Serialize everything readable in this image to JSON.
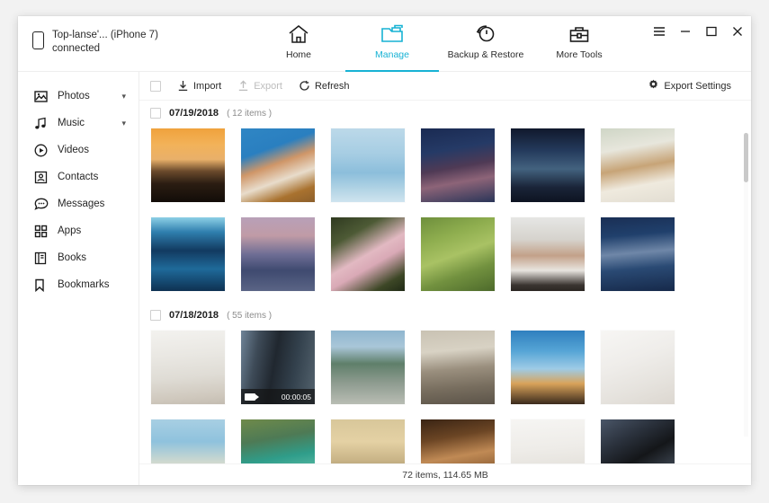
{
  "window": {
    "device_name": "Top-lanse'... (iPhone 7)",
    "device_status": "connected",
    "controls": [
      {
        "name": "menu",
        "glyph": "☰"
      },
      {
        "name": "minimize",
        "glyph": "−"
      },
      {
        "name": "maximize",
        "glyph": "☐"
      },
      {
        "name": "close",
        "glyph": "✕"
      }
    ]
  },
  "tabs": [
    {
      "id": "home",
      "label": "Home",
      "icon": "home-icon",
      "active": false
    },
    {
      "id": "manage",
      "label": "Manage",
      "icon": "folder-icon",
      "active": true
    },
    {
      "id": "backup",
      "label": "Backup & Restore",
      "icon": "restore-icon",
      "active": false
    },
    {
      "id": "tools",
      "label": "More Tools",
      "icon": "toolbox-icon",
      "active": false
    }
  ],
  "accent_color": "#17b2d4",
  "sidebar": {
    "items": [
      {
        "label": "Photos",
        "icon": "photo-icon",
        "expandable": true
      },
      {
        "label": "Music",
        "icon": "music-note-icon",
        "expandable": true
      },
      {
        "label": "Videos",
        "icon": "play-circle-icon",
        "expandable": false
      },
      {
        "label": "Contacts",
        "icon": "contact-card-icon",
        "expandable": false
      },
      {
        "label": "Messages",
        "icon": "chat-bubble-icon",
        "expandable": false
      },
      {
        "label": "Apps",
        "icon": "grid-squares-icon",
        "expandable": false
      },
      {
        "label": "Books",
        "icon": "book-icon",
        "expandable": false
      },
      {
        "label": "Bookmarks",
        "icon": "bookmark-icon",
        "expandable": false
      }
    ]
  },
  "toolbar": {
    "import_label": "Import",
    "export_label": "Export",
    "refresh_label": "Refresh",
    "export_settings_label": "Export Settings",
    "export_disabled": true
  },
  "groups": [
    {
      "date": "07/19/2018",
      "count_label": "( 12 items )",
      "items": [
        {
          "kind": "photo",
          "desc": "orange-sunset-beach",
          "art": "linear-gradient(180deg,#f0a23c 0%,#f2b259 22%,#e9b06a 42%,#6b4a2c 58%,#2b1d12 75%,#120c08 100%)"
        },
        {
          "kind": "photo",
          "desc": "woman-sunhat-pool",
          "art": "linear-gradient(160deg,#2f86c4 0%,#2a7fc0 30%,#cf9668 48%,#e8dccb 66%,#a9722f 84%,#8c5f2b 100%)"
        },
        {
          "kind": "photo",
          "desc": "aerial-pool-swimmer",
          "art": "linear-gradient(180deg,#bcd9e9 0%,#a6cde3 35%,#8cbedb 60%,#b6d6e6 85%,#cfe4ef 100%)"
        },
        {
          "kind": "photo",
          "desc": "cherry-blossom-night",
          "art": "linear-gradient(170deg,#1a2a52 0%,#253a66 30%,#4f3a55 52%,#8d6478 70%,#2a3558 100%)"
        },
        {
          "kind": "photo",
          "desc": "japan-alley-lanterns",
          "art": "linear-gradient(180deg,#10182c 0%,#243a5c 30%,#43627f 55%,#1a2438 80%,#0d1321 100%)"
        },
        {
          "kind": "photo",
          "desc": "deer-in-snow",
          "art": "linear-gradient(170deg,#cfd6c6 0%,#e7e6dc 28%,#c7a477 52%,#efeade 74%,#e2ddd2 100%)"
        },
        {
          "kind": "photo",
          "desc": "beluga-whale-tank",
          "art": "linear-gradient(180deg,#8dd0e6 0%,#2f7fae 20%,#123a60 45%,#1f6a9a 70%,#0e3152 100%)"
        },
        {
          "kind": "photo",
          "desc": "dusk-mountain-lake",
          "art": "linear-gradient(180deg,#b8a0b8 0%,#c09ba6 25%,#6f6e95 50%,#3f4a70 72%,#5a6485 100%)"
        },
        {
          "kind": "photo",
          "desc": "pink-hydrangea-flower",
          "art": "linear-gradient(150deg,#2f3a20 0%,#4d5a35 25%,#e2b9c2 50%,#d9a9b6 62%,#3d4726 85%,#202a16 100%)"
        },
        {
          "kind": "photo",
          "desc": "aerial-green-rice-fields",
          "art": "linear-gradient(160deg,#6e8f3c 0%,#8fae4f 28%,#a9c264 50%,#72913f 72%,#4d6a2b 100%)"
        },
        {
          "kind": "photo",
          "desc": "hands-washing-vegetables",
          "art": "linear-gradient(180deg,#e6e6e4 0%,#d6d3cd 30%,#c3a189 52%,#e8e4df 72%,#3a3430 92%,#2b2622 100%)"
        },
        {
          "kind": "photo",
          "desc": "dark-ocean-waves",
          "art": "linear-gradient(175deg,#1a2f55 0%,#20406c 25%,#6f87a8 48%,#2a4a74 68%,#16294a 100%)"
        }
      ]
    },
    {
      "date": "07/18/2018",
      "count_label": "( 55 items )",
      "items": [
        {
          "kind": "photo",
          "desc": "white-living-room-sofa",
          "art": "linear-gradient(175deg,#f3f2ef 0%,#e9e7e2 35%,#dfdcd5 62%,#cfc8bd 88%,#c3bcb1 100%)"
        },
        {
          "kind": "video",
          "desc": "city-skyscraper-tower",
          "duration": "00:00:05",
          "art": "linear-gradient(100deg,#6f8498 0%,#3e4b58 22%,#20272f 45%,#33414d 70%,#55646f 100%)"
        },
        {
          "kind": "photo",
          "desc": "girl-sitting-by-lake",
          "art": "linear-gradient(180deg,#8fb6cf 0%,#a9c6d8 22%,#5f7f6a 45%,#8c9a8e 70%,#b9bdb4 100%)"
        },
        {
          "kind": "photo",
          "desc": "woman-at-st-peters-square",
          "art": "linear-gradient(175deg,#c9c2b3 0%,#d8d2c4 28%,#9a8f7e 52%,#776d5e 76%,#5c5449 100%)"
        },
        {
          "kind": "photo",
          "desc": "friends-jumping-silhouette-sunset",
          "art": "linear-gradient(180deg,#2f7fbe 0%,#56a5d6 28%,#9ecbe6 52%,#d9a35a 72%,#3a2a1c 100%)"
        },
        {
          "kind": "photo",
          "desc": "white-tshirt-flatlay",
          "art": "linear-gradient(160deg,#f7f6f4 0%,#efedea 40%,#e6e3de 70%,#dcd7d0 100%)"
        },
        {
          "kind": "photo",
          "desc": "beach-with-boats",
          "art": "linear-gradient(180deg,#a8cfe3 0%,#8fc2dd 30%,#cfd9cf 58%,#e3ded0 80%,#d6cfc0 100%)"
        },
        {
          "kind": "photo",
          "desc": "green-lagoon-cliffs",
          "art": "linear-gradient(170deg,#6f8a4a 0%,#4e7a55 28%,#2f9d8a 52%,#57b8a2 72%,#8ea862 100%)"
        },
        {
          "kind": "photo",
          "desc": "couple-sunset-beach-silhouette",
          "art": "linear-gradient(180deg,#d8c79a 0%,#e4d1a4 30%,#c9b487 55%,#9a8a66 80%,#7a6e52 100%)"
        },
        {
          "kind": "photo",
          "desc": "family-candlelight-portrait",
          "art": "linear-gradient(170deg,#3a2414 0%,#6b4524 26%,#c08a55 50%,#8a5c32 74%,#2e1d10 100%)"
        },
        {
          "kind": "photo",
          "desc": "pendant-lamp-white-wall",
          "art": "linear-gradient(175deg,#f6f5f3 0%,#eeece8 40%,#e3e0da 72%,#d8d4cd 100%)"
        },
        {
          "kind": "photo",
          "desc": "person-holding-black-cat",
          "art": "linear-gradient(150deg,#4a5668 0%,#2b323d 28%,#141619 52%,#3d4652 78%,#6a7482 100%)"
        }
      ]
    }
  ],
  "statusbar": {
    "summary": "72 items, 114.65 MB"
  }
}
